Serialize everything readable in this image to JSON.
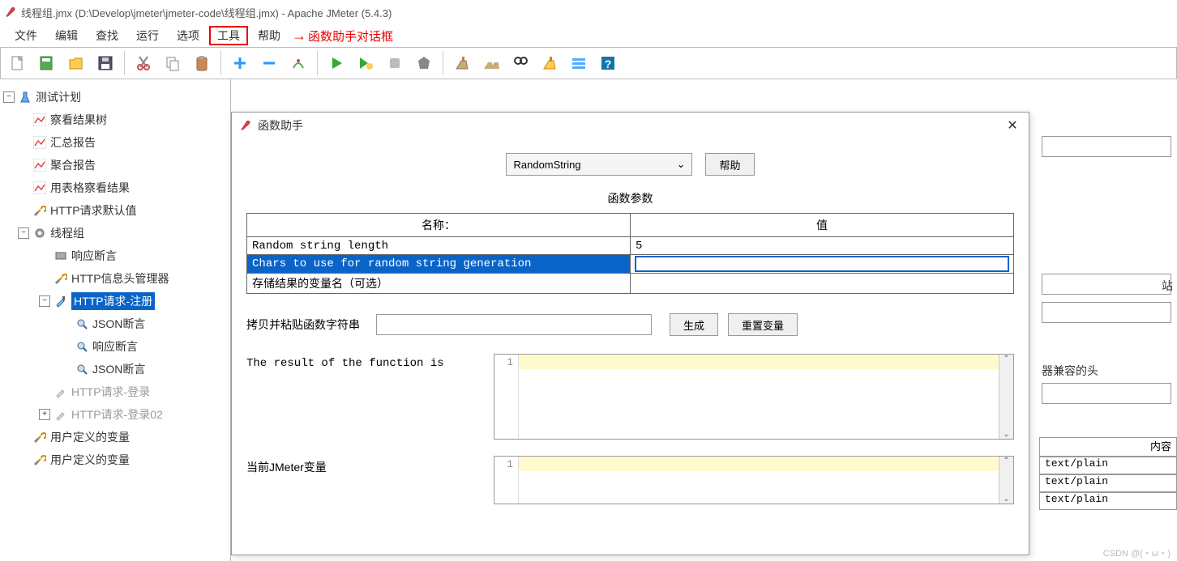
{
  "window": {
    "title": "线程组.jmx (D:\\Develop\\jmeter\\jmeter-code\\线程组.jmx) - Apache JMeter (5.4.3)"
  },
  "menu": {
    "file": "文件",
    "edit": "编辑",
    "search": "查找",
    "run": "运行",
    "options": "选项",
    "tools": "工具",
    "help": "帮助"
  },
  "annotation": {
    "text": "函数助手对话框"
  },
  "tree": {
    "plan": "测试计划",
    "view_results_tree": "察看结果树",
    "summary_report": "汇总报告",
    "aggregate_report": "聚合报告",
    "table_results": "用表格察看结果",
    "http_defaults": "HTTP请求默认值",
    "thread_group": "线程组",
    "response_assertion": "响应断言",
    "header_mgr": "HTTP信息头管理器",
    "http_register": "HTTP请求-注册",
    "json_assert1": "JSON断言",
    "response_assert2": "响应断言",
    "json_assert2": "JSON断言",
    "http_login": "HTTP请求-登录",
    "http_login02": "HTTP请求-登录02",
    "user_vars1": "用户定义的变量",
    "user_vars2": "用户定义的变量"
  },
  "dialog": {
    "title": "函数助手",
    "function_name": "RandomString",
    "help_btn": "帮助",
    "params_title": "函数参数",
    "col_name": "名称：",
    "col_value": "值",
    "rows": [
      {
        "name": "Random string length",
        "value": "5"
      },
      {
        "name": "Chars to use for random string generation",
        "value": ""
      },
      {
        "name": "存储结果的变量名（可选）",
        "value": ""
      }
    ],
    "copy_label": "拷贝并粘贴函数字符串",
    "generate_btn": "生成",
    "reset_btn": "重置变量",
    "result_label": "The result of the function is",
    "vars_label": "当前JMeter变量",
    "line_num": "1"
  },
  "bg": {
    "compat_header": "器兼容的头",
    "port_label": "站",
    "content_header": "内容",
    "rows": [
      "text/plain",
      "text/plain",
      "text/plain"
    ]
  },
  "watermark": "CSDN @(・ω・)"
}
